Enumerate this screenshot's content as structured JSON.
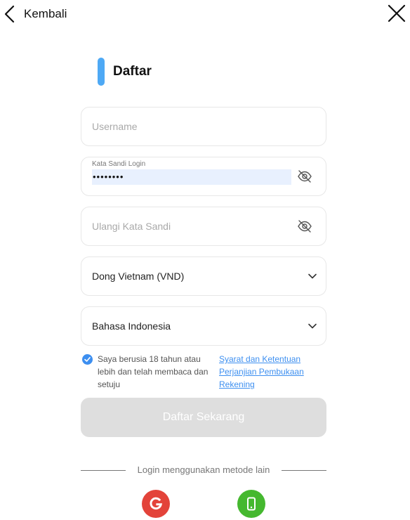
{
  "header": {
    "back_label": "Kembali",
    "back_icon": "chevron-left-icon",
    "close_icon": "close-icon"
  },
  "page": {
    "title": "Daftar",
    "accent_color": "#4ea9f5"
  },
  "form": {
    "username_placeholder": "Username",
    "password_label": "Kata Sandi Login",
    "password_value": "••••••••",
    "confirm_placeholder": "Ulangi Kata Sandi",
    "currency_value": "Dong Vietnam (VND)",
    "language_value": "Bahasa Indonesia"
  },
  "agreement": {
    "checked": true,
    "text": "Saya berusia 18 tahun atau lebih dan telah membaca dan setuju",
    "link_terms": "Syarat dan Ketentuan",
    "link_account": "Perjanjian Pembukaan Rekening",
    "link_color": "#3d8ff0"
  },
  "submit": {
    "label": "Daftar Sekarang",
    "disabled_color": "#dedede"
  },
  "alt_login": {
    "text": "Login menggunakan metode lain",
    "google_icon": "google-icon",
    "phone_icon": "phone-icon",
    "google_color": "#e3433a",
    "phone_color": "#45b82f"
  }
}
